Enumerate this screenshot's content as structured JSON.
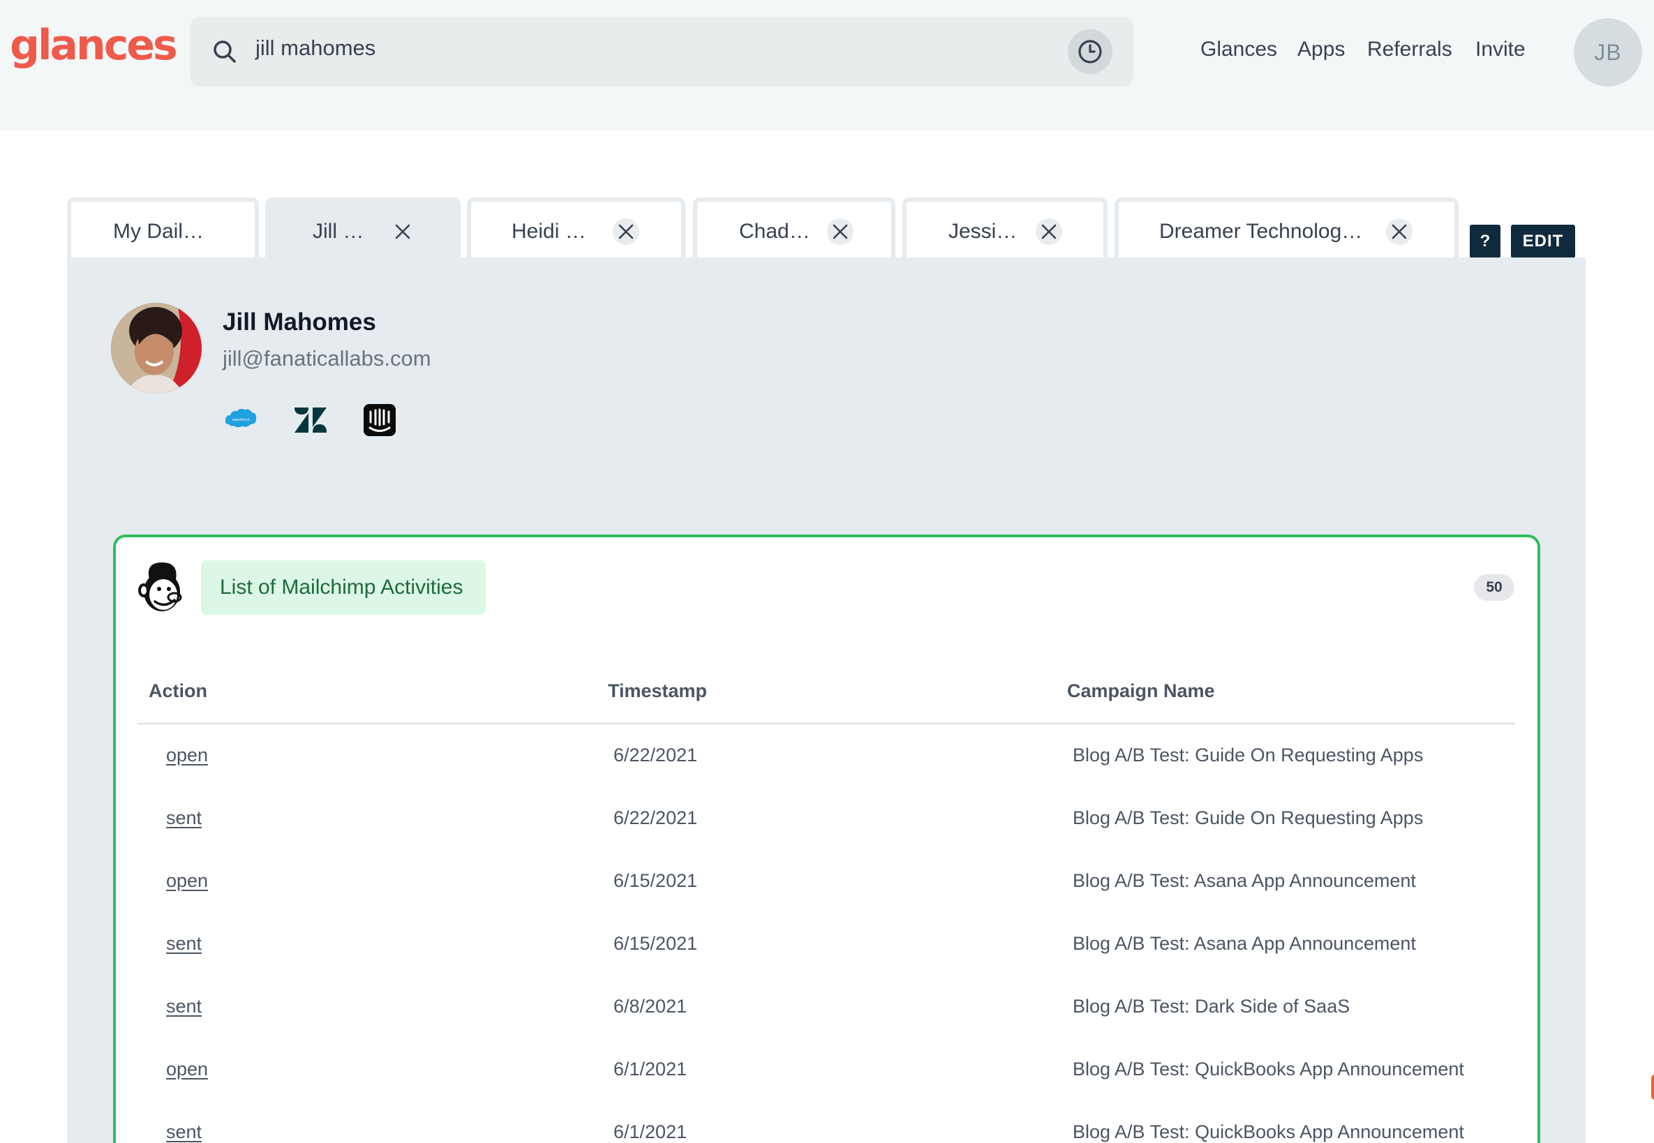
{
  "brand": {
    "logo_text": "glances",
    "accent": "#ef5a4a"
  },
  "search": {
    "value": "jill mahomes",
    "icon": "search-icon",
    "history_icon": "clock-icon"
  },
  "nav": {
    "items": [
      "Glances",
      "Apps",
      "Referrals",
      "Invite"
    ]
  },
  "user": {
    "initials": "JB"
  },
  "tabs": [
    {
      "label": "My Dail…",
      "closable": false,
      "active": false
    },
    {
      "label": "Jill …",
      "closable": true,
      "active": true
    },
    {
      "label": "Heidi …",
      "closable": true,
      "active": false
    },
    {
      "label": "Chad…",
      "closable": true,
      "active": false
    },
    {
      "label": "Jessi…",
      "closable": true,
      "active": false
    },
    {
      "label": "Dreamer Technolog…",
      "closable": true,
      "active": false
    }
  ],
  "toolbar": {
    "help_label": "?",
    "edit_label": "EDIT"
  },
  "profile": {
    "name": "Jill Mahomes",
    "email": "jill@fanaticallabs.com",
    "integrations": [
      "salesforce-icon",
      "zendesk-icon",
      "intercom-icon"
    ],
    "salesforce_text": "salesforce"
  },
  "card": {
    "icon": "mailchimp-icon",
    "title": "List of Mailchimp Activities",
    "count": "50",
    "border_color": "#2fbf5c",
    "columns": [
      "Action",
      "Timestamp",
      "Campaign Name"
    ],
    "rows": [
      {
        "action": "open",
        "timestamp": "6/22/2021",
        "campaign": "Blog A/B Test: Guide On Requesting Apps"
      },
      {
        "action": "sent",
        "timestamp": "6/22/2021",
        "campaign": "Blog A/B Test: Guide On Requesting Apps"
      },
      {
        "action": "open",
        "timestamp": "6/15/2021",
        "campaign": "Blog A/B Test: Asana App Announcement"
      },
      {
        "action": "sent",
        "timestamp": "6/15/2021",
        "campaign": "Blog A/B Test: Asana App Announcement"
      },
      {
        "action": "sent",
        "timestamp": "6/8/2021",
        "campaign": "Blog A/B Test: Dark Side of SaaS"
      },
      {
        "action": "open",
        "timestamp": "6/1/2021",
        "campaign": "Blog A/B Test: QuickBooks App Announcement"
      },
      {
        "action": "sent",
        "timestamp": "6/1/2021",
        "campaign": "Blog A/B Test: QuickBooks App Announcement"
      }
    ]
  }
}
